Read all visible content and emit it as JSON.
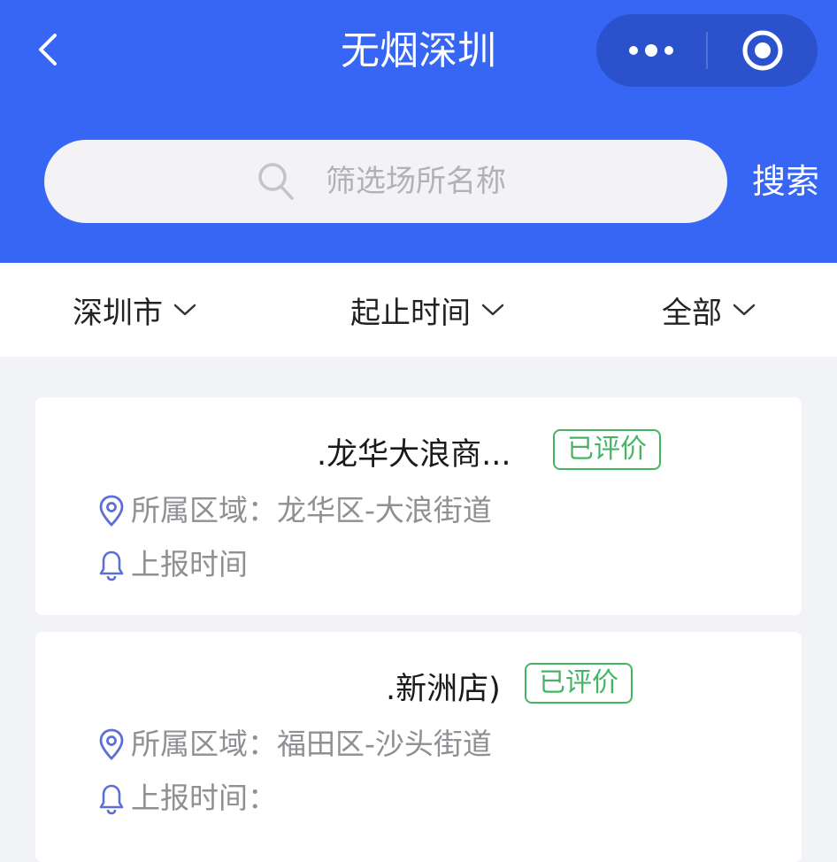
{
  "header": {
    "title": "无烟深圳",
    "back_icon": "chevron-left-icon",
    "more_icon": "more-dots-icon",
    "close_icon": "target-circle-icon",
    "background_color": "#3766f4"
  },
  "search": {
    "placeholder": "筛选场所名称",
    "button_label": "搜索"
  },
  "filters": [
    {
      "label": "深圳市"
    },
    {
      "label": "起止时间"
    },
    {
      "label": "全部"
    }
  ],
  "cards": [
    {
      "title": ".龙华大浪商...",
      "tag": "已评价",
      "region": "所属区域：龙华区-大浪街道",
      "report_time": "上报时间"
    },
    {
      "title": ".新洲店)",
      "tag": "已评价",
      "region": "所属区域：福田区-沙头街道",
      "report_time": "上报时间："
    }
  ],
  "colors": {
    "accent": "#3766f4",
    "tag_green": "#45b565",
    "icon_blue": "#5b6fd6",
    "meta_gray": "#8f8f94"
  }
}
